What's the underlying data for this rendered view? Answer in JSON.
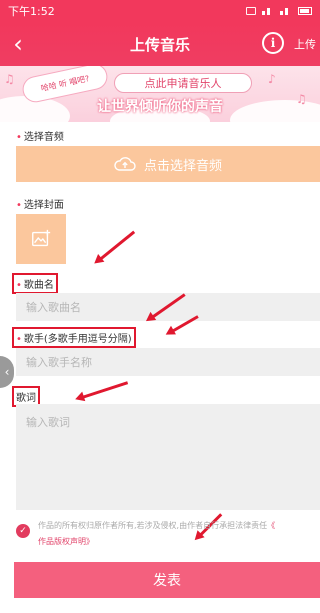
{
  "status_bar": {
    "time": "下午1:52"
  },
  "nav": {
    "back_icon": "back-arrow-icon",
    "title": "上传音乐",
    "info_icon": "info-icon",
    "upload_link": "上传"
  },
  "banner": {
    "bubble_text": "哈哈 听 唱吧?",
    "apply_button": "点此申请音乐人",
    "slogan": "让世界倾听你的声音"
  },
  "form": {
    "audio_label": "选择音频",
    "audio_button": "点击选择音频",
    "cover_label": "选择封面",
    "song_name_label": "歌曲名",
    "song_name_placeholder": "输入歌曲名",
    "singer_label": "歌手(多歌手用逗号分隔)",
    "singer_placeholder": "输入歌手名称",
    "lyrics_label": "歌词",
    "lyrics_placeholder": "输入歌词"
  },
  "agreement": {
    "text": "作品的所有权归原作者所有,若涉及侵权,由作者自行承担法律责任",
    "link_prefix": "《",
    "link": "作品版权声明》"
  },
  "submit_button": "发表",
  "side_tab_icon": "chevron-left-icon",
  "colors": {
    "primary": "#f2385c",
    "accent": "#fbc79d",
    "annotation": "#e0182f"
  }
}
